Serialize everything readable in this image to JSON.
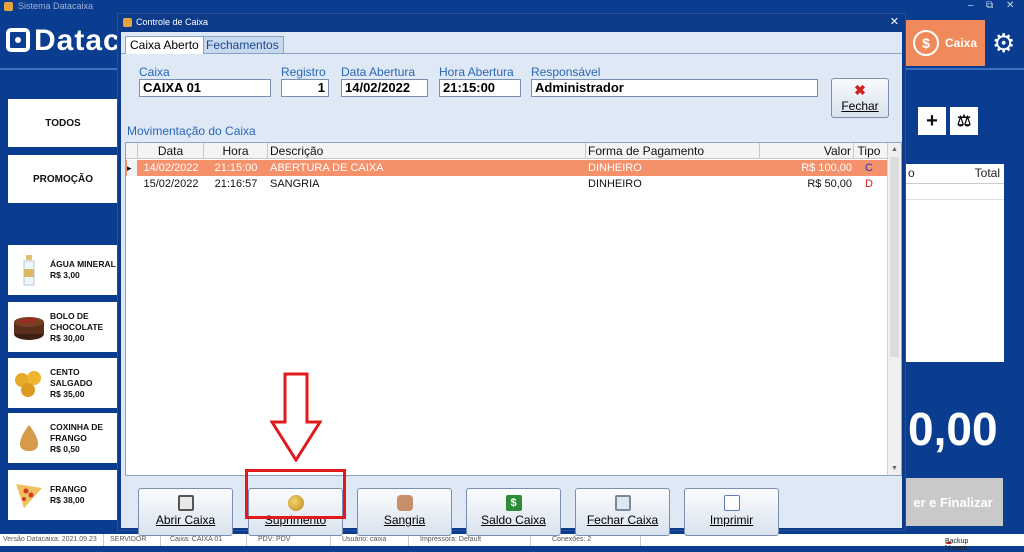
{
  "app": {
    "window_title": "Sistema Datacaixa",
    "logo_text": "Datac",
    "window_controls": [
      "–",
      "⧉",
      "✕"
    ],
    "categories": [
      "TODOS",
      "PROMOÇÃO"
    ],
    "products": [
      {
        "name_l1": "ÁGUA MINERAL",
        "name_l2": "",
        "price": "R$ 3,00",
        "icon": "water-bottle-icon"
      },
      {
        "name_l1": "BOLO DE",
        "name_l2": "CHOCOLATE",
        "price": "R$ 30,00",
        "icon": "chocolate-cake-icon"
      },
      {
        "name_l1": "CENTO",
        "name_l2": "SALGADO",
        "price": "R$ 35,00",
        "icon": "snacks-icon"
      },
      {
        "name_l1": "COXINHA DE",
        "name_l2": "FRANGO",
        "price": "R$ 0,50",
        "icon": "coxinha-icon"
      },
      {
        "name_l1": "FRANGO",
        "name_l2": "",
        "price": "R$ 38,00",
        "icon": "pizza-icon"
      }
    ],
    "caixa_tab": "Caixa",
    "caixa_symbol": "$",
    "gear_symbol": "⚙",
    "plus_symbol": "+",
    "scale_symbol": "⚖",
    "right_table_partial": "o",
    "right_table_header_total": "Total",
    "big_total": "0,00",
    "finalizar_partial": "er e Finalizar"
  },
  "statusbar": {
    "version": "Versão Datacaixa: 2021.09.23",
    "server": "SERVIDOR",
    "caixa": "Caixa: CAIXA 01",
    "pdv": "PDV: PDV",
    "usuario": "Usuário: caixa",
    "impressora": "Impressora: Default",
    "conexoes": "Conexões: 2",
    "backup": "Backup Nuvem"
  },
  "dialog": {
    "title": "Controle de Caixa",
    "close_symbol": "✕",
    "tabs": [
      "Caixa Aberto",
      "Fechamentos"
    ],
    "fields": {
      "caixa_label": "Caixa",
      "caixa_value": "CAIXA 01",
      "registro_label": "Registro",
      "registro_value": "1",
      "data_label": "Data Abertura",
      "data_value": "14/02/2022",
      "hora_label": "Hora Abertura",
      "hora_value": "21:15:00",
      "resp_label": "Responsável",
      "resp_value": "Administrador"
    },
    "fechar_label": "Fechar",
    "fechar_symbol": "✖",
    "section_label": "Movimentação do Caixa",
    "columns": [
      "Data",
      "Hora",
      "Descrição",
      "Forma de Pagamento",
      "Valor",
      "Tipo"
    ],
    "rows": [
      {
        "data": "14/02/2022",
        "hora": "21:15:00",
        "descricao": "ABERTURA DE CAIXA",
        "forma": "DINHEIRO",
        "valor": "R$ 100,00",
        "tipo": "C"
      },
      {
        "data": "15/02/2022",
        "hora": "21:16:57",
        "descricao": "SANGRIA",
        "forma": "DINHEIRO",
        "valor": "R$ 50,00",
        "tipo": "D"
      }
    ],
    "row_indicator": "▸",
    "actions": [
      "Abrir Caixa",
      "Suprimento",
      "Sangria",
      "Saldo Caixa",
      "Fechar Caixa",
      "Imprimir"
    ],
    "action_icons": [
      "open-register-icon",
      "coins-icon",
      "hand-money-icon",
      "dollar-note-icon",
      "close-register-icon",
      "print-preview-icon"
    ],
    "action_icon_colors": [
      "#8a8a8a",
      "#d4a52a",
      "#b07a4a",
      "#2e8b3a",
      "#7a8a9a",
      "#5a7ab8"
    ],
    "accent": "#f18a5b",
    "highlight_color": "#e0191c"
  }
}
